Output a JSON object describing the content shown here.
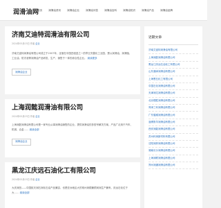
{
  "header": {
    "logo": "润滑油网",
    "nav": [
      "首页",
      "润滑油资讯",
      "润滑油企业",
      "润滑油问答",
      "润滑油百科",
      "润滑油知识",
      "润滑油产品",
      "润滑油品牌"
    ]
  },
  "posts": [
    {
      "title": "济南艾迪特润滑油有限公司",
      "date": "2024年05月03日",
      "author": "作者",
      "category": "企业",
      "excerpt": "济南艾迪特润滑油有限公司成立于2007年，坐落在中国四强县之一的章丘完善化工业园，是以润滑油、润滑脂、工业油、防冻液等润滑油产品研发、生产、销售于一体的综合性企业。",
      "more": "阅读更多",
      "button": "润滑油企业"
    },
    {
      "title": "上海润懿润滑油有限公司",
      "date": "2024年05月03日",
      "author": "作者",
      "category": "企业",
      "excerpt": "上海润懿润滑油有限公司是一家专业从事润滑油销售的企业，提供润滑油的多型号解决方案。产品广泛用于汽车、机械、合金……",
      "more": "阅读全部",
      "button": "润滑油企业"
    },
    {
      "title": "黑龙江庆远石油化工有限公司",
      "date": "2024年05月03日",
      "author": "作者",
      "category": "企业",
      "excerpt": "大庆润田——中国航天润石润化石油产品兼容、也是亚洲地区大的常州润顺兼顾润润生产兼有，庆远石化位于大……",
      "more": "阅读全部"
    }
  ],
  "sidebar": {
    "title": "近期文章",
    "items": [
      "济南艾迪特润滑油有限公司",
      "上海润懿润滑油有限公司",
      "黑龙江庆远石油化工有限公司",
      "山东通泽润滑油有限公司",
      "上海恩石化工有限公司",
      "中国石化润滑油有限公司",
      "天津润达润滑油有限公司",
      "北京德胜润滑油有限公司",
      "菏泽三利润滑油有限公司",
      "广东骏威润滑油有限公司",
      "淄博鲁华润滑油有限公司",
      "西安润能润滑油有限公司",
      "苏州科润新材料有限公司",
      "沈阳润邦润滑油有限公司",
      "湖南长沙润滑油有限公司",
      "上海润联润滑油有限公司",
      "郑州润通润滑油有限公司"
    ]
  }
}
